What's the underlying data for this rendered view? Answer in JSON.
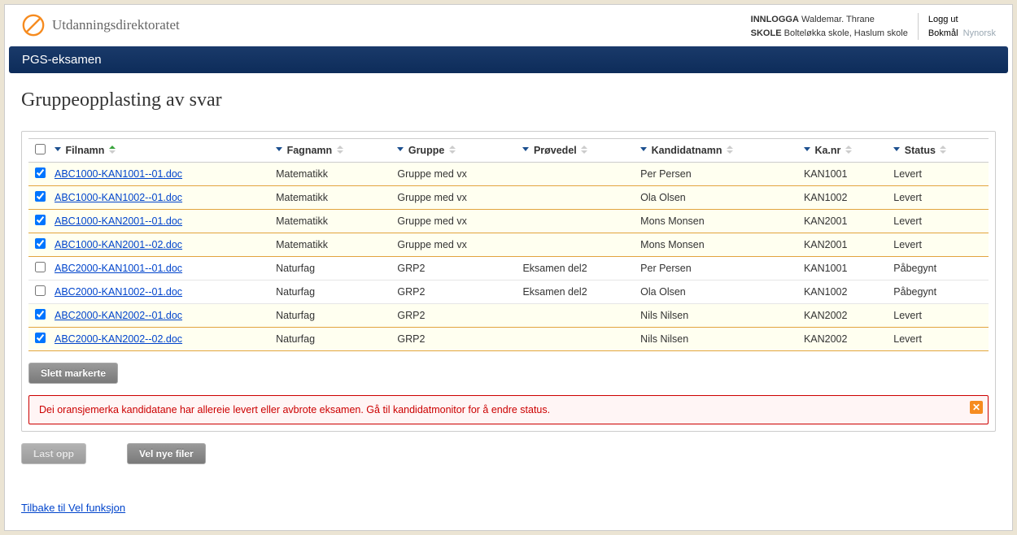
{
  "header": {
    "org_name": "Utdanningsdirektoratet",
    "logged_in_label": "INNLOGGA",
    "logged_in_user": "Waldemar. Thrane",
    "school_label": "SKOLE",
    "school_name": "Bolteløkka skole, Haslum skole",
    "logout": "Logg ut",
    "lang1": "Bokmål",
    "lang2": "Nynorsk"
  },
  "blue_bar": "PGS-eksamen",
  "page_title": "Gruppeopplasting av svar",
  "columns": {
    "filnamn": "Filnamn",
    "fagnamn": "Fagnamn",
    "gruppe": "Gruppe",
    "provedel": "Prøvedel",
    "kandidatnamn": "Kandidatnamn",
    "kanr": "Ka.nr",
    "status": "Status"
  },
  "rows": [
    {
      "checked": true,
      "file": "ABC1000-KAN1001--01.doc",
      "fag": "Matematikk",
      "gruppe": "Gruppe med vx",
      "provedel": "",
      "kandidat": "Per Persen",
      "kanr": "KAN1001",
      "status": "Levert",
      "sel": true
    },
    {
      "checked": true,
      "file": "ABC1000-KAN1002--01.doc",
      "fag": "Matematikk",
      "gruppe": "Gruppe med vx",
      "provedel": "",
      "kandidat": "Ola Olsen",
      "kanr": "KAN1002",
      "status": "Levert",
      "sel": true
    },
    {
      "checked": true,
      "file": "ABC1000-KAN2001--01.doc",
      "fag": "Matematikk",
      "gruppe": "Gruppe med vx",
      "provedel": "",
      "kandidat": "Mons Monsen",
      "kanr": "KAN2001",
      "status": "Levert",
      "sel": true
    },
    {
      "checked": true,
      "file": "ABC1000-KAN2001--02.doc",
      "fag": "Matematikk",
      "gruppe": "Gruppe med vx",
      "provedel": "",
      "kandidat": "Mons Monsen",
      "kanr": "KAN2001",
      "status": "Levert",
      "sel": true
    },
    {
      "checked": false,
      "file": "ABC2000-KAN1001--01.doc",
      "fag": "Naturfag",
      "gruppe": "GRP2",
      "provedel": "Eksamen del2",
      "kandidat": "Per Persen",
      "kanr": "KAN1001",
      "status": "Påbegynt",
      "sel": false
    },
    {
      "checked": false,
      "file": "ABC2000-KAN1002--01.doc",
      "fag": "Naturfag",
      "gruppe": "GRP2",
      "provedel": "Eksamen del2",
      "kandidat": "Ola Olsen",
      "kanr": "KAN1002",
      "status": "Påbegynt",
      "sel": false
    },
    {
      "checked": true,
      "file": "ABC2000-KAN2002--01.doc",
      "fag": "Naturfag",
      "gruppe": "GRP2",
      "provedel": "",
      "kandidat": "Nils Nilsen",
      "kanr": "KAN2002",
      "status": "Levert",
      "sel": true
    },
    {
      "checked": true,
      "file": "ABC2000-KAN2002--02.doc",
      "fag": "Naturfag",
      "gruppe": "GRP2",
      "provedel": "",
      "kandidat": "Nils Nilsen",
      "kanr": "KAN2002",
      "status": "Levert",
      "sel": true
    }
  ],
  "buttons": {
    "slett_markerte": "Slett markerte",
    "last_opp": "Last opp",
    "vel_nye_filer": "Vel nye filer"
  },
  "warning_text": "Dei oransjemerka kandidatane har allereie levert eller avbrote eksamen. Gå til kandidatmonitor for å endre status.",
  "back_link": "Tilbake til Vel funksjon"
}
